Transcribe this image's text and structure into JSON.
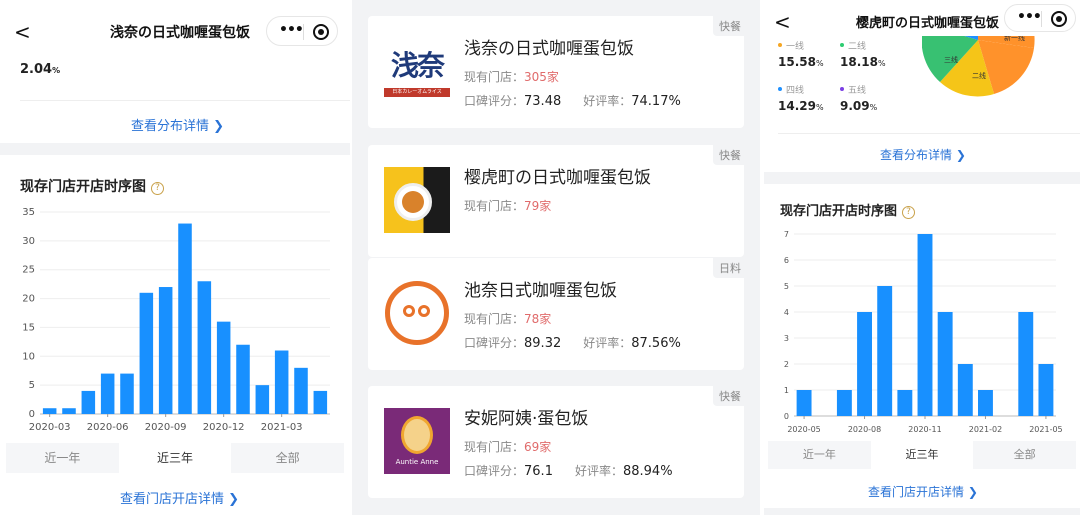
{
  "panel1": {
    "nav": {
      "back": "<",
      "title": "浅奈の日式咖喱蛋包饭"
    },
    "top_value": "2.04",
    "top_value_unit": "%",
    "dist_link": "查看分布详情 ❯",
    "chart_title": "现存门店开店时序图",
    "tabs": [
      "近一年",
      "近三年",
      "全部"
    ],
    "detail_link": "查看门店开店详情 ❯"
  },
  "panel2": {
    "cards": [
      {
        "tag": "快餐",
        "name": "浅奈の日式咖喱蛋包饭",
        "stores_label": "现有门店：",
        "stores": "305",
        "stores_unit": "家",
        "rating_label": "口碑评分：",
        "rating": "73.48",
        "good_label": "好评率：",
        "good": "74.17%",
        "logo_text": "浅奈",
        "logo_sub": "日本カレーオムライス"
      },
      {
        "tag": "快餐",
        "name": "樱虎町の日式咖喱蛋包饭",
        "stores_label": "现有门店：",
        "stores": "79",
        "stores_unit": "家"
      },
      {
        "tag": "日料",
        "name": "池奈日式咖喱蛋包饭",
        "stores_label": "现有门店：",
        "stores": "78",
        "stores_unit": "家",
        "rating_label": "口碑评分：",
        "rating": "89.32",
        "good_label": "好评率：",
        "good": "87.56%"
      },
      {
        "tag": "快餐",
        "name": "安妮阿姨·蛋包饭",
        "stores_label": "现有门店：",
        "stores": "69",
        "stores_unit": "家",
        "rating_label": "口碑评分：",
        "rating": "76.1",
        "good_label": "好评率：",
        "good": "88.94%",
        "logo_text": "Auntie Anne"
      }
    ]
  },
  "panel3": {
    "nav": {
      "back": "<",
      "title": "樱虎町の日式咖喱蛋包饭"
    },
    "legend": [
      {
        "label": "一线",
        "value": "15.58",
        "unit": "%",
        "color": "#f5a623"
      },
      {
        "label": "二线",
        "value": "18.18",
        "unit": "%",
        "color": "#2ecc71"
      },
      {
        "label": "四线",
        "value": "14.29",
        "unit": "%",
        "color": "#1e90ff"
      },
      {
        "label": "五线",
        "value": "9.09",
        "unit": "%",
        "color": "#7b3fe4"
      }
    ],
    "pie_labels": [
      "新一线",
      "三线",
      "二线"
    ],
    "dist_link": "查看分布详情 ❯",
    "chart_title": "现存门店开店时序图",
    "tabs": [
      "近一年",
      "近三年",
      "全部"
    ],
    "detail_link": "查看门店开店详情 ❯"
  },
  "chart_data": [
    {
      "type": "bar",
      "title": "现存门店开店时序图",
      "x_tick_labels": [
        "2020-03",
        "2020-06",
        "2020-09",
        "2020-12",
        "2021-03"
      ],
      "values": [
        1,
        1,
        4,
        7,
        7,
        21,
        22,
        33,
        23,
        16,
        12,
        5,
        11,
        8,
        4
      ],
      "yticks": [
        0,
        5,
        10,
        15,
        20,
        25,
        30,
        35
      ],
      "ylim": [
        0,
        35
      ],
      "color": "#1890ff"
    },
    {
      "type": "bar",
      "title": "现存门店开店时序图",
      "x_tick_labels": [
        "2020-05",
        "2020-08",
        "2020-11",
        "2021-02",
        "2021-05"
      ],
      "values": [
        1,
        0,
        1,
        4,
        5,
        1,
        7,
        4,
        2,
        1,
        0,
        4,
        2
      ],
      "yticks": [
        0,
        1,
        2,
        3,
        4,
        5,
        6,
        7
      ],
      "ylim": [
        0,
        7
      ],
      "color": "#1890ff"
    }
  ]
}
